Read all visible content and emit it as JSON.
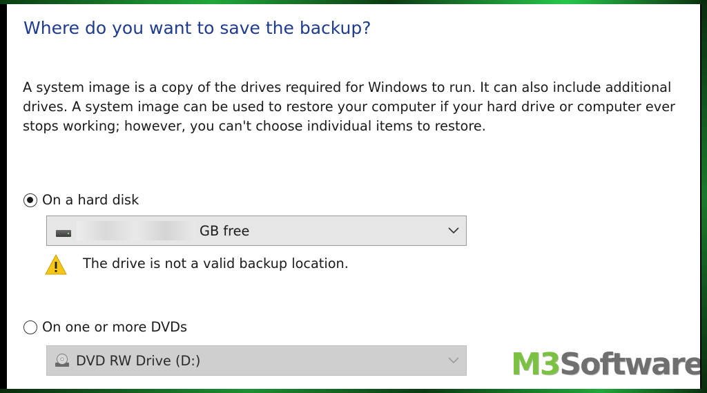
{
  "dialog": {
    "title": "Where do you want to save the backup?",
    "description": "A system image is a copy of the drives required for Windows to run. It can also include additional drives. A system image can be used to restore your computer if your hard drive or computer ever stops working; however, you can't choose individual items to restore."
  },
  "hard_disk_option": {
    "label": "On a hard disk",
    "selected": true,
    "dropdown": {
      "value_suffix": "GB free",
      "icon": "hard-drive-icon"
    },
    "warning": {
      "icon": "warning-icon",
      "text": "The drive is not a valid backup location."
    }
  },
  "dvd_option": {
    "label": "On one or more DVDs",
    "selected": false,
    "dropdown": {
      "value": "DVD RW Drive (D:)",
      "icon": "dvd-drive-icon"
    }
  },
  "watermark": {
    "brand_part1": "M3",
    "brand_part2": "Software",
    "colors": {
      "part1": "#7cc242",
      "part2": "#6f6f6f"
    }
  },
  "colors": {
    "title": "#1e3b8f",
    "frame_glow": "#1fa83a"
  }
}
